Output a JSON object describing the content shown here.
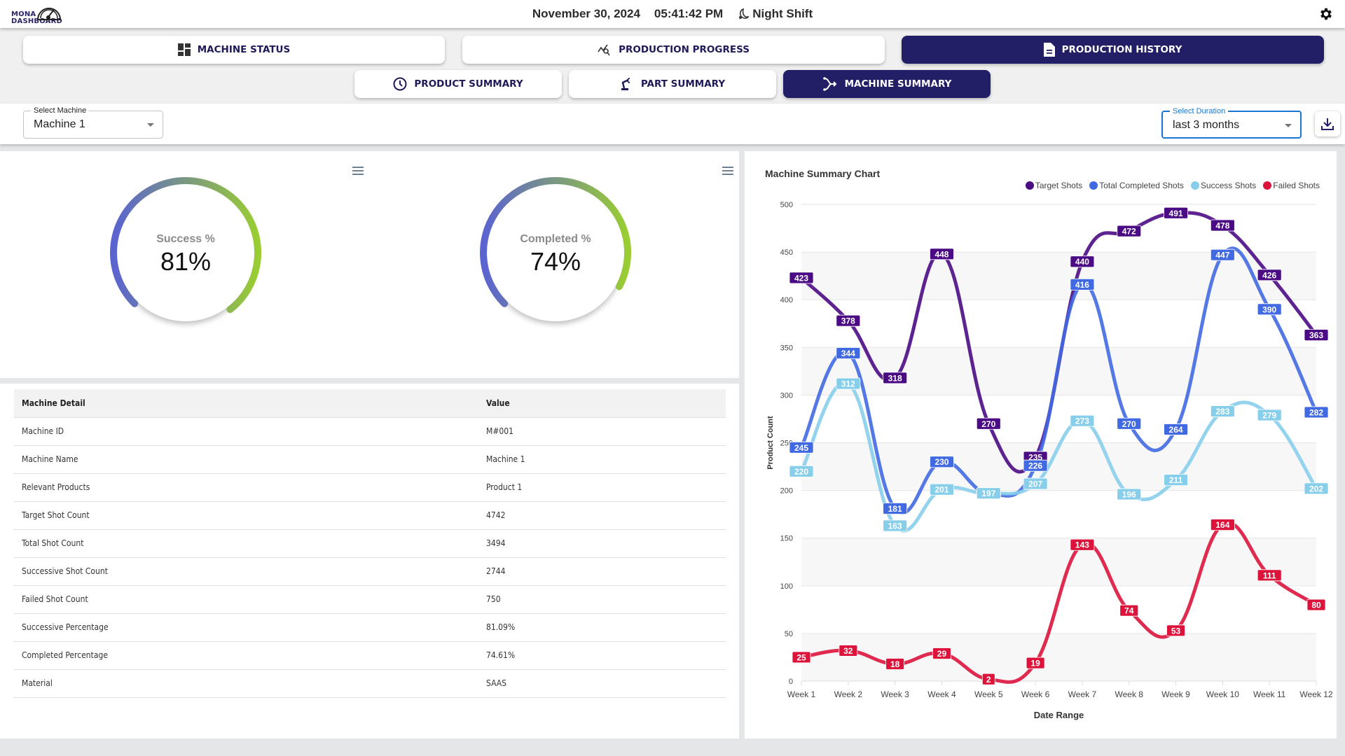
{
  "header": {
    "logo_line1": "MONA",
    "logo_line2": "DASHBOARD",
    "date": "November 30, 2024",
    "time": "05:41:42 PM",
    "shift": "Night Shift",
    "shift_icon": "moon-icon",
    "settings_icon": "gear-icon"
  },
  "nav": {
    "primary": [
      {
        "label": "MACHINE STATUS",
        "icon": "dashboard-grid-icon",
        "active": false
      },
      {
        "label": "PRODUCTION PROGRESS",
        "icon": "query-stats-icon",
        "active": false
      },
      {
        "label": "PRODUCTION HISTORY",
        "icon": "document-icon",
        "active": true
      }
    ],
    "secondary": [
      {
        "label": "PRODUCT SUMMARY",
        "icon": "clock-icon",
        "active": false
      },
      {
        "label": "PART SUMMARY",
        "icon": "robot-arm-icon",
        "active": false
      },
      {
        "label": "MACHINE SUMMARY",
        "icon": "merge-arrow-icon",
        "active": true
      }
    ]
  },
  "filters": {
    "machine": {
      "label": "Select Machine",
      "value": "Machine 1"
    },
    "duration": {
      "label": "Select Duration",
      "value": "last 3 months"
    },
    "download_icon": "download-icon"
  },
  "gauges": [
    {
      "label": "Success %",
      "value_text": "81%",
      "value": 81
    },
    {
      "label": "Completed %",
      "value_text": "74%",
      "value": 74
    }
  ],
  "colors": {
    "brand": "#231f67",
    "target": "#4b0b85",
    "completed": "#4169e1",
    "success": "#87ceeb",
    "failed": "#dc143c",
    "gauge_start": "#5b63d0",
    "gauge_end": "#9acd32"
  },
  "table": {
    "headers": [
      "Machine Detail",
      "Value"
    ],
    "rows": [
      [
        "Machine ID",
        "M#001"
      ],
      [
        "Machine Name",
        "Machine 1"
      ],
      [
        "Relevant Products",
        "Product 1"
      ],
      [
        "Target Shot Count",
        "4742"
      ],
      [
        "Total Shot Count",
        "3494"
      ],
      [
        "Successive Shot Count",
        "2744"
      ],
      [
        "Failed Shot Count",
        "750"
      ],
      [
        "Successive Percentage",
        "81.09%"
      ],
      [
        "Completed Percentage",
        "74.61%"
      ],
      [
        "Material",
        "SAAS"
      ]
    ]
  },
  "chart_data": {
    "type": "line",
    "title": "Machine Summary Chart",
    "xlabel": "Date Range",
    "ylabel": "Product Count",
    "ylim": [
      0,
      500
    ],
    "yticks": [
      0,
      50,
      100,
      150,
      200,
      250,
      300,
      350,
      400,
      450,
      500
    ],
    "grid": true,
    "legend_position": "top-right",
    "categories": [
      "Week 1",
      "Week 2",
      "Week 3",
      "Week 4",
      "Week 5",
      "Week 6",
      "Week 7",
      "Week 8",
      "Week 9",
      "Week 10",
      "Week 11",
      "Week 12"
    ],
    "series": [
      {
        "name": "Target Shots",
        "color": "#4b0b85",
        "values": [
          423,
          378,
          318,
          448,
          270,
          235,
          440,
          472,
          491,
          478,
          426,
          363
        ]
      },
      {
        "name": "Total Completed Shots",
        "color": "#4169e1",
        "values": [
          245,
          344,
          181,
          230,
          197,
          226,
          416,
          270,
          264,
          447,
          390,
          282
        ]
      },
      {
        "name": "Success Shots",
        "color": "#87ceeb",
        "values": [
          220,
          312,
          163,
          201,
          197,
          207,
          273,
          196,
          211,
          283,
          279,
          202
        ]
      },
      {
        "name": "Failed Shots",
        "color": "#dc143c",
        "values": [
          25,
          32,
          18,
          29,
          2,
          19,
          143,
          74,
          53,
          164,
          111,
          80
        ]
      }
    ]
  }
}
